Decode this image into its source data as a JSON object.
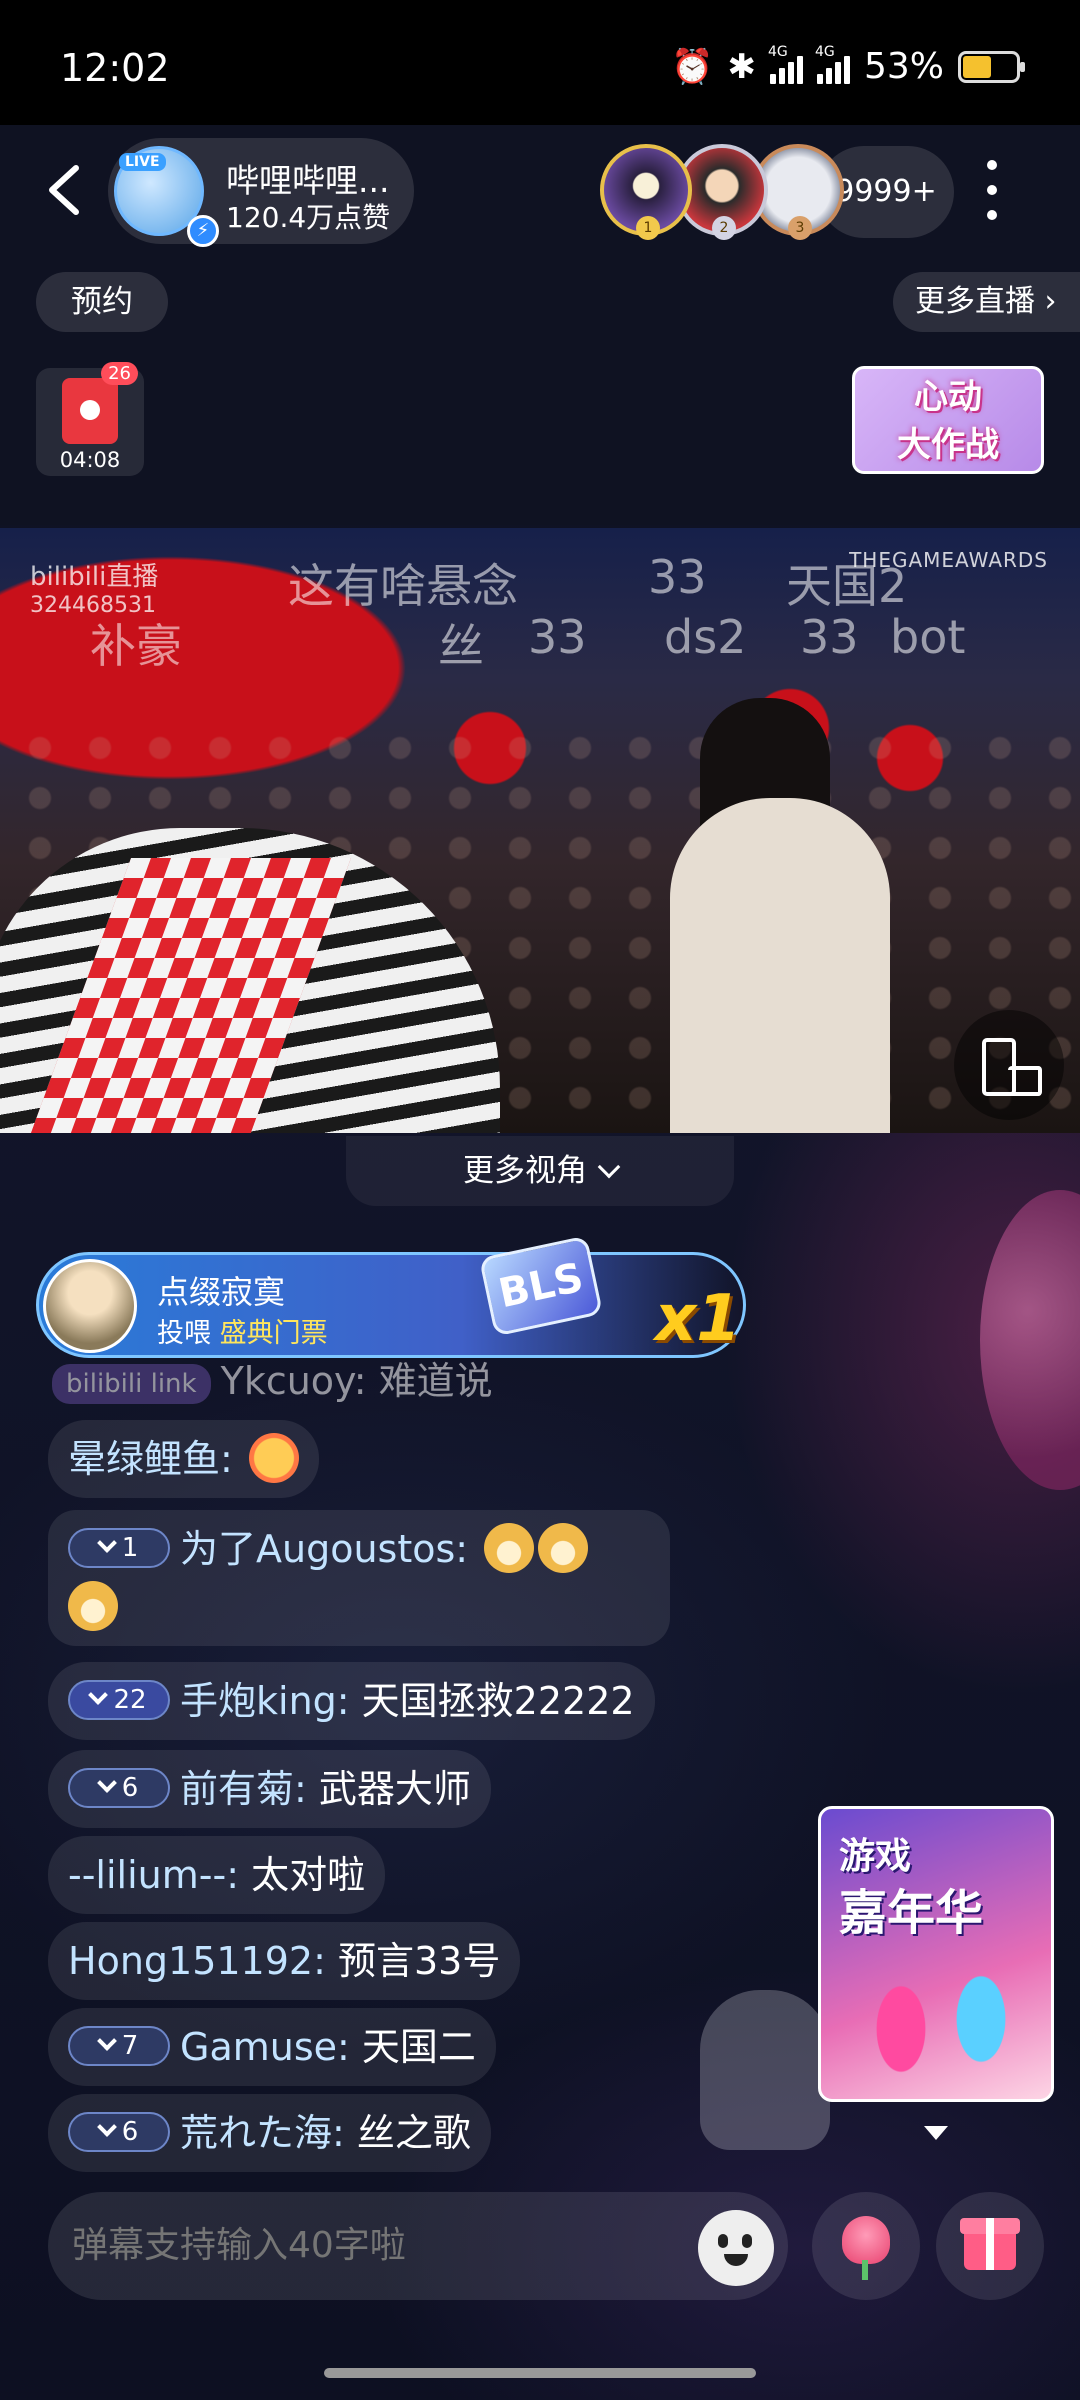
{
  "status_bar": {
    "time": "12:02",
    "network_label": "4G",
    "battery": "53%",
    "battery_level": 0.53,
    "icons": [
      "alarm-icon",
      "bluetooth-icon",
      "signal-icon",
      "signal-icon",
      "battery-icon"
    ]
  },
  "header": {
    "anchor_name": "哔哩哔哩...",
    "likes": "120.4万点赞",
    "live_tag": "LIVE",
    "rank_badges": [
      "1",
      "2",
      "3"
    ],
    "viewer_count": "9999+",
    "reserve_label": "预约",
    "more_live_label": "更多直播",
    "red_packet_count": "26",
    "red_packet_timer": "04:08",
    "event_banner_line1": "心动",
    "event_banner_line2": "大作战"
  },
  "video": {
    "watermark_brand": "bilibili直播",
    "watermark_room": "324468531",
    "corner_logo": "THEGAMEAWARDS",
    "danmaku": [
      {
        "text": "这有啥悬念"
      },
      {
        "text": "33"
      },
      {
        "text": "天国2"
      },
      {
        "text": "补豪"
      },
      {
        "text": "丝"
      },
      {
        "text": "33"
      },
      {
        "text": "ds2"
      },
      {
        "text": "33"
      },
      {
        "text": "bot"
      }
    ]
  },
  "more_angles_label": "更多视角",
  "gift": {
    "user": "点缀寂寞",
    "action": "投喂",
    "item": "盛典门票",
    "gift_icon_text": "BLS",
    "count": "x1"
  },
  "chat": {
    "faded_row": {
      "tag": "bilibili link",
      "user": "Ykcuoy",
      "msg": "难道说"
    },
    "rows": [
      {
        "medal": "",
        "user": "晕绿鲤鱼",
        "msg": ""
      },
      {
        "medal": "1",
        "user": "为了Augoustos",
        "msg": ""
      },
      {
        "medal": "22",
        "user": "手炮king",
        "msg": "天国拯救22222"
      },
      {
        "medal": "6",
        "user": "前有菊",
        "msg": "武器大师"
      },
      {
        "medal": "",
        "user": "--lilium--",
        "msg": "太对啦"
      },
      {
        "medal": "",
        "user": "Hong151192",
        "msg": "预言33号"
      },
      {
        "medal": "7",
        "user": "Gamuse",
        "msg": "天国二"
      },
      {
        "medal": "6",
        "user": "荒れた海",
        "msg": "丝之歌"
      }
    ]
  },
  "side_banner": {
    "line1": "游戏",
    "line2": "嘉年华"
  },
  "input": {
    "placeholder": "弹幕支持输入40字啦"
  },
  "colors": {
    "accent": "#2f8cff",
    "gift_count": "#ffcc1e",
    "username": "#c3e3ff"
  }
}
